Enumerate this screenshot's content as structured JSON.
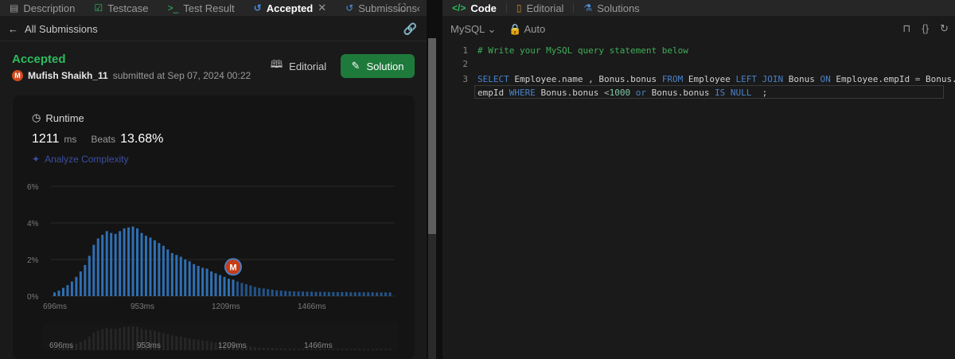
{
  "left_tabs": [
    {
      "label": "Description",
      "icon": "description-icon",
      "active": false
    },
    {
      "label": "Testcase",
      "icon": "checkbox-icon",
      "active": false
    },
    {
      "label": "Test Result",
      "icon": "terminal-icon",
      "active": false
    },
    {
      "label": "Accepted",
      "icon": "history-icon",
      "active": true
    },
    {
      "label": "Submissions",
      "icon": "history-icon",
      "active": false
    }
  ],
  "back_label": "All Submissions",
  "status": "Accepted",
  "submitter": {
    "avatar_letter": "M",
    "name": "Mufish Shaikh_11",
    "meta": "submitted at Sep 07, 2024 00:22"
  },
  "buttons": {
    "editorial": "Editorial",
    "solution": "Solution"
  },
  "runtime": {
    "label": "Runtime",
    "value": "1211",
    "unit": "ms",
    "beats_label": "Beats",
    "beats_value": "13.68%",
    "analyze": "Analyze Complexity"
  },
  "chart_data": {
    "type": "bar",
    "y_ticks": [
      "6%",
      "4%",
      "2%",
      "0%"
    ],
    "ylim": [
      0,
      6
    ],
    "x_ticks": [
      "696ms",
      "953ms",
      "1209ms",
      "1466ms"
    ],
    "marker_label": "M",
    "marker_index": 41,
    "values": [
      0.2,
      0.3,
      0.45,
      0.6,
      0.8,
      1.05,
      1.35,
      1.7,
      2.2,
      2.8,
      3.15,
      3.35,
      3.55,
      3.45,
      3.4,
      3.55,
      3.7,
      3.75,
      3.8,
      3.7,
      3.45,
      3.3,
      3.2,
      3.05,
      2.9,
      2.75,
      2.55,
      2.35,
      2.25,
      2.15,
      2.0,
      1.9,
      1.75,
      1.65,
      1.55,
      1.5,
      1.35,
      1.25,
      1.15,
      1.05,
      0.95,
      0.9,
      0.8,
      0.72,
      0.65,
      0.58,
      0.5,
      0.45,
      0.42,
      0.38,
      0.35,
      0.32,
      0.3,
      0.28,
      0.27,
      0.26,
      0.25,
      0.25,
      0.24,
      0.24,
      0.23,
      0.23,
      0.23,
      0.22,
      0.22,
      0.22,
      0.22,
      0.22,
      0.21,
      0.21,
      0.21,
      0.21,
      0.21,
      0.21,
      0.2,
      0.2,
      0.2,
      0.2
    ]
  },
  "code_tabs": [
    {
      "label": "Code",
      "icon": "code-icon",
      "active": true
    },
    {
      "label": "Editorial",
      "icon": "book-icon",
      "active": false
    },
    {
      "label": "Solutions",
      "icon": "flask-icon",
      "active": false
    }
  ],
  "language": "MySQL",
  "auto_label": "Auto",
  "code_lines": [
    {
      "n": "1",
      "tokens": [
        {
          "t": "# Write your MySQL query statement below",
          "c": "c-comment"
        }
      ]
    },
    {
      "n": "2",
      "tokens": []
    },
    {
      "n": "3",
      "tokens": [
        {
          "t": "SELECT",
          "c": "c-kw"
        },
        {
          "t": " Employee.name , Bonus.bonus ",
          "c": "c-id"
        },
        {
          "t": "FROM",
          "c": "c-kw"
        },
        {
          "t": " Employee ",
          "c": "c-id"
        },
        {
          "t": "LEFT JOIN",
          "c": "c-kw"
        },
        {
          "t": " Bonus ",
          "c": "c-id"
        },
        {
          "t": "ON",
          "c": "c-kw"
        },
        {
          "t": " Employee.empId ",
          "c": "c-id"
        },
        {
          "t": "=",
          "c": "c-op"
        },
        {
          "t": " Bonus.",
          "c": "c-id"
        }
      ]
    },
    {
      "n": "",
      "tokens": [
        {
          "t": "empId ",
          "c": "c-id"
        },
        {
          "t": "WHERE",
          "c": "c-kw"
        },
        {
          "t": " Bonus.bonus ",
          "c": "c-id"
        },
        {
          "t": "<",
          "c": "c-op"
        },
        {
          "t": "1000",
          "c": "c-num"
        },
        {
          "t": " ",
          "c": "c-id"
        },
        {
          "t": "or",
          "c": "c-kw"
        },
        {
          "t": " Bonus.bonus ",
          "c": "c-id"
        },
        {
          "t": "IS NULL",
          "c": "c-kw"
        },
        {
          "t": "  ;",
          "c": "c-id"
        }
      ]
    }
  ]
}
